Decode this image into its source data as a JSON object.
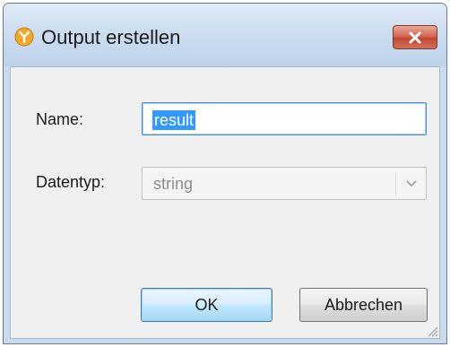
{
  "window": {
    "title": "Output erstellen",
    "icon": "altova-mapforce-icon"
  },
  "form": {
    "name_label": "Name:",
    "name_value": "result",
    "type_label": "Datentyp:",
    "type_value": "string"
  },
  "buttons": {
    "ok_label": "OK",
    "cancel_label": "Abbrechen"
  },
  "colors": {
    "selection": "#3399ff",
    "close_button": "#c04631",
    "icon_orange": "#f5a623"
  }
}
